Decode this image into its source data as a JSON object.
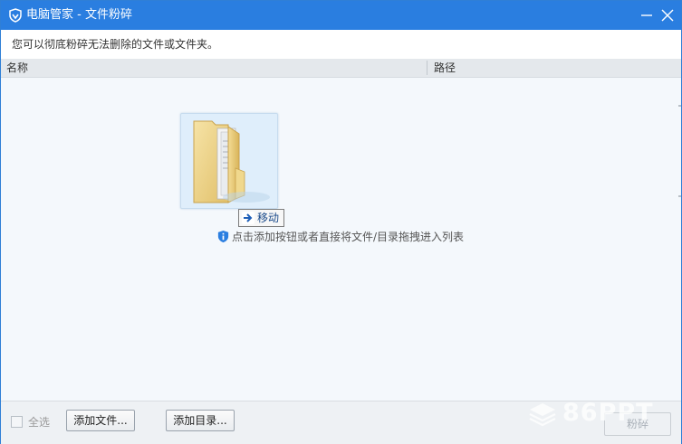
{
  "window": {
    "title": "电脑管家 - 文件粉碎",
    "accent_color": "#2a7ee0",
    "controls": [
      "minimize-icon",
      "close-icon"
    ]
  },
  "info": {
    "text": "您可以彻底粉碎无法删除的文件或文件夹。"
  },
  "list": {
    "columns": [
      "名称",
      "路径"
    ],
    "drag_tip": "移动",
    "hint": "点击添加按钮或者直接将文件/目录拖拽进入列表"
  },
  "footer": {
    "select_all_label": "全选",
    "add_file_label": "添加文件...",
    "add_dir_label": "添加目录...",
    "shred_label": "粉碎"
  },
  "watermark": {
    "text": "86PPT"
  }
}
